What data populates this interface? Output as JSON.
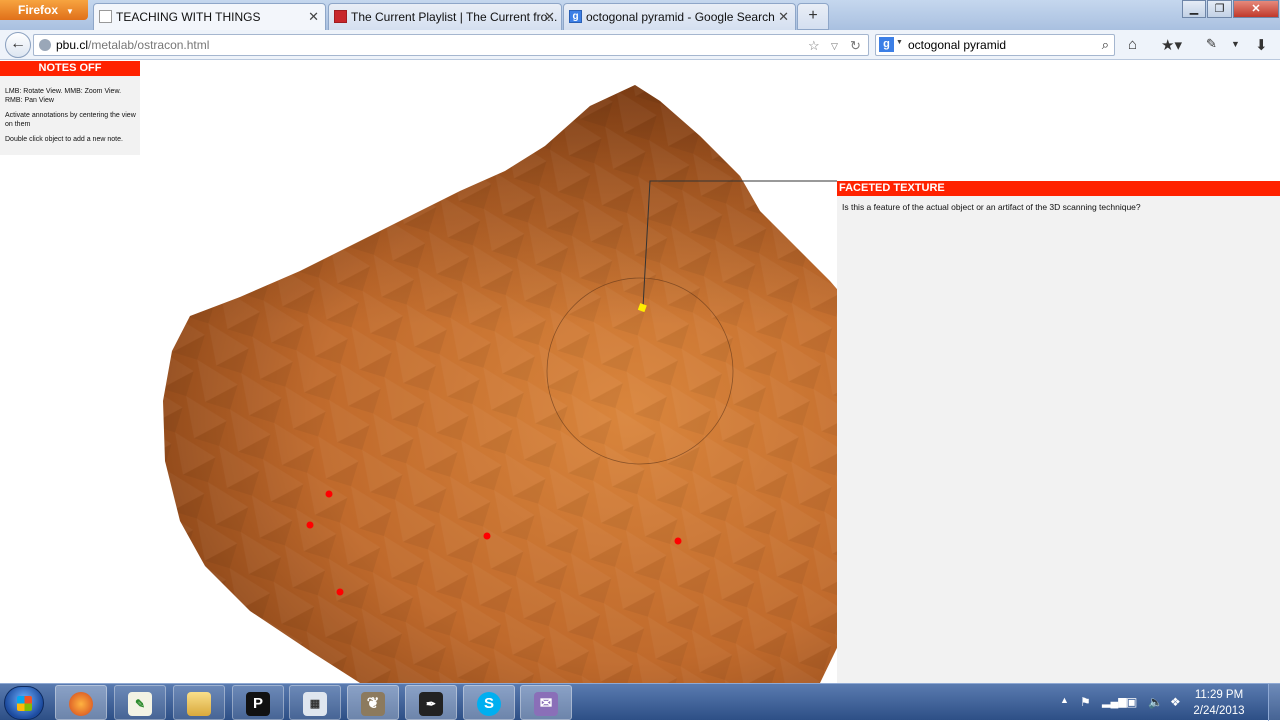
{
  "browser": {
    "app_button": "Firefox",
    "tabs": [
      {
        "title": "TEACHING WITH THINGS",
        "active": true
      },
      {
        "title": "The Current Playlist | The Current fro...",
        "active": false
      },
      {
        "title": "octogonal pyramid - Google Search",
        "active": false
      }
    ],
    "new_tab": "+",
    "url": {
      "domain": "pbu.cl",
      "path": "/metalab/ostracon.html"
    },
    "search_query": "octogonal pyramid"
  },
  "page": {
    "notes_toggle": "NOTES OFF",
    "help": [
      "LMB: Rotate View. MMB: Zoom View. RMB: Pan View",
      "Activate annotations by centering the view on them",
      "Double click object to add a new note."
    ],
    "annotation": {
      "title": "FACETED TEXTURE",
      "body": "Is this a feature of the actual object or an artifact of the 3D scanning technique?"
    },
    "colors": {
      "accent": "#ff2200",
      "panel": "#f2f2f2",
      "object": "#c06a2c",
      "marker": "#ff0000",
      "active_marker": "#ffee00"
    }
  },
  "taskbar": {
    "apps": [
      "firefox-icon",
      "notepad-icon",
      "explorer-folder-icon",
      "p-app-icon",
      "calculator-icon",
      "gimp-icon",
      "inkscape-icon",
      "skype-icon",
      "pidgin-icon"
    ],
    "clock_time": "11:29 PM",
    "clock_date": "2/24/2013"
  }
}
